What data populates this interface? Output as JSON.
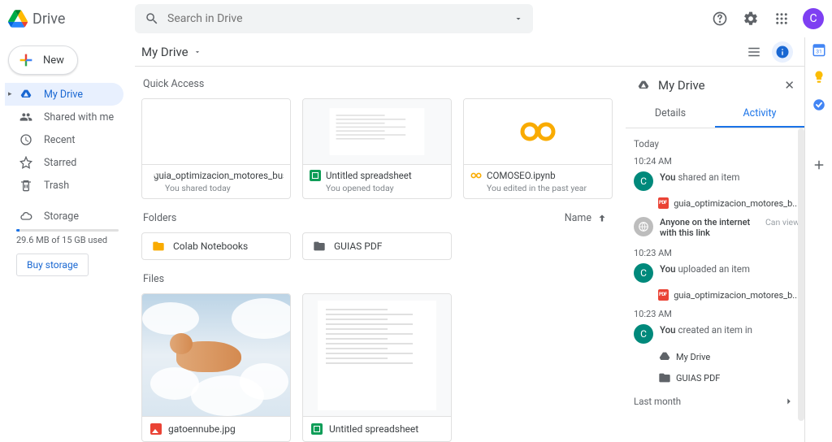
{
  "header": {
    "product": "Drive",
    "search_placeholder": "Search in Drive",
    "avatar_letter": "C"
  },
  "sidebar": {
    "new_label": "New",
    "items": [
      {
        "label": "My Drive",
        "icon": "drive"
      },
      {
        "label": "Shared with me",
        "icon": "people"
      },
      {
        "label": "Recent",
        "icon": "clock"
      },
      {
        "label": "Starred",
        "icon": "star"
      },
      {
        "label": "Trash",
        "icon": "trash"
      }
    ],
    "storage_label": "Storage",
    "storage_used": "29.6 MB of 15 GB used",
    "buy_label": "Buy storage"
  },
  "toolbar": {
    "path": "My Drive"
  },
  "content": {
    "quick_access_label": "Quick Access",
    "quick": [
      {
        "title": "guia_optimizacion_motores_busqu...",
        "sub": "You shared today",
        "icon": "pdf"
      },
      {
        "title": "Untitled spreadsheet",
        "sub": "You opened today",
        "icon": "sheet"
      },
      {
        "title": "COMOSEO.ipynb",
        "sub": "You edited in the past year",
        "icon": "colab"
      }
    ],
    "folders_label": "Folders",
    "sort_label": "Name",
    "folders": [
      {
        "name": "Colab Notebooks"
      },
      {
        "name": "GUIAS PDF"
      }
    ],
    "files_label": "Files",
    "files": [
      {
        "name": "gatoennube.jpg",
        "icon": "img"
      },
      {
        "name": "Untitled spreadsheet",
        "icon": "sheet"
      }
    ]
  },
  "panel": {
    "title": "My Drive",
    "tabs": {
      "details": "Details",
      "activity": "Activity"
    },
    "today": "Today",
    "lastmonth": "Last month",
    "events": [
      {
        "time": "10:24 AM",
        "text_bold": "You",
        "text_rest": " shared an item",
        "file": "guia_optimizacion_motores_b...",
        "file_icon": "pdf",
        "sub_main": "Anyone on the internet with this link",
        "sub_right": "Can view",
        "sub_icon": "globe"
      },
      {
        "time": "10:23 AM",
        "text_bold": "You",
        "text_rest": " uploaded an item",
        "file": "guia_optimizacion_motores_b...",
        "file_icon": "pdf"
      },
      {
        "time": "10:23 AM",
        "text_bold": "You",
        "text_rest": " created an item in",
        "file": "My Drive",
        "file_icon": "drive",
        "file2": "GUIAS PDF",
        "file2_icon": "folder"
      }
    ]
  }
}
